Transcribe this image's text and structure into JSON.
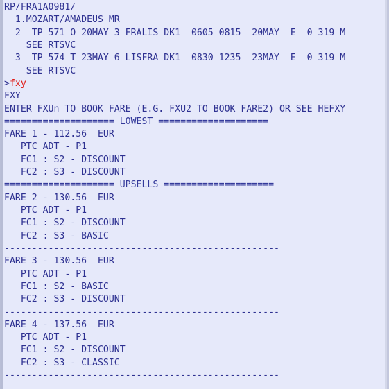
{
  "terminal": {
    "app": "amadeus-gds-terminal",
    "colors": {
      "background": "#e6e9fa",
      "text": "#2e3191",
      "command_echo": "#e01b16",
      "border": "#b7bcd4"
    },
    "prompt_symbol": ">",
    "command_entered": "fxy",
    "lines": [
      {
        "name": "record-locator",
        "text": "RP/FRA1A0981/",
        "type": "plain"
      },
      {
        "name": "passenger-name-1",
        "text": "  1.MOZART/AMADEUS MR",
        "type": "plain"
      },
      {
        "name": "segment-2",
        "text": "  2  TP 571 O 20MAY 3 FRALIS DK1  0605 0815  20MAY  E  0 319 M",
        "type": "plain"
      },
      {
        "name": "segment-2-note",
        "text": "    SEE RTSVC",
        "type": "plain"
      },
      {
        "name": "segment-3",
        "text": "  3  TP 574 T 23MAY 6 LISFRA DK1  0830 1235  23MAY  E  0 319 M",
        "type": "plain"
      },
      {
        "name": "segment-3-note",
        "text": "    SEE RTSVC",
        "type": "plain"
      },
      {
        "name": "command-prompt",
        "text": "fxy",
        "type": "command"
      },
      {
        "name": "command-echo",
        "text": "FXY",
        "type": "plain"
      },
      {
        "name": "instruction-line",
        "text": "ENTER FXUn TO BOOK FARE (E.G. FXU2 TO BOOK FARE2) OR SEE HEFXY",
        "type": "plain"
      },
      {
        "name": "separator-lowest",
        "text": "==================== LOWEST ====================",
        "type": "separator"
      },
      {
        "name": "fare-1-header",
        "text": "FARE 1 - 112.56  EUR",
        "type": "plain"
      },
      {
        "name": "fare-1-ptc",
        "text": "   PTC ADT - P1",
        "type": "plain"
      },
      {
        "name": "fare-1-fc1",
        "text": "   FC1 : S2 - DISCOUNT",
        "type": "plain"
      },
      {
        "name": "fare-1-fc2",
        "text": "   FC2 : S3 - DISCOUNT",
        "type": "plain"
      },
      {
        "name": "separator-upsells",
        "text": "==================== UPSELLS ====================",
        "type": "separator"
      },
      {
        "name": "fare-2-header",
        "text": "FARE 2 - 130.56  EUR",
        "type": "plain"
      },
      {
        "name": "fare-2-ptc",
        "text": "   PTC ADT - P1",
        "type": "plain"
      },
      {
        "name": "fare-2-fc1",
        "text": "   FC1 : S2 - DISCOUNT",
        "type": "plain"
      },
      {
        "name": "fare-2-fc2",
        "text": "   FC2 : S3 - BASIC",
        "type": "plain"
      },
      {
        "name": "divider-1",
        "text": "--------------------------------------------------",
        "type": "divider"
      },
      {
        "name": "fare-3-header",
        "text": "FARE 3 - 130.56  EUR",
        "type": "plain"
      },
      {
        "name": "fare-3-ptc",
        "text": "   PTC ADT - P1",
        "type": "plain"
      },
      {
        "name": "fare-3-fc1",
        "text": "   FC1 : S2 - BASIC",
        "type": "plain"
      },
      {
        "name": "fare-3-fc2",
        "text": "   FC2 : S3 - DISCOUNT",
        "type": "plain"
      },
      {
        "name": "divider-2",
        "text": "--------------------------------------------------",
        "type": "divider"
      },
      {
        "name": "fare-4-header",
        "text": "FARE 4 - 137.56  EUR",
        "type": "plain"
      },
      {
        "name": "fare-4-ptc",
        "text": "   PTC ADT - P1",
        "type": "plain"
      },
      {
        "name": "fare-4-fc1",
        "text": "   FC1 : S2 - DISCOUNT",
        "type": "plain"
      },
      {
        "name": "fare-4-fc2",
        "text": "   FC2 : S3 - CLASSIC",
        "type": "plain"
      },
      {
        "name": "divider-3",
        "text": "--------------------------------------------------",
        "type": "divider"
      }
    ]
  }
}
